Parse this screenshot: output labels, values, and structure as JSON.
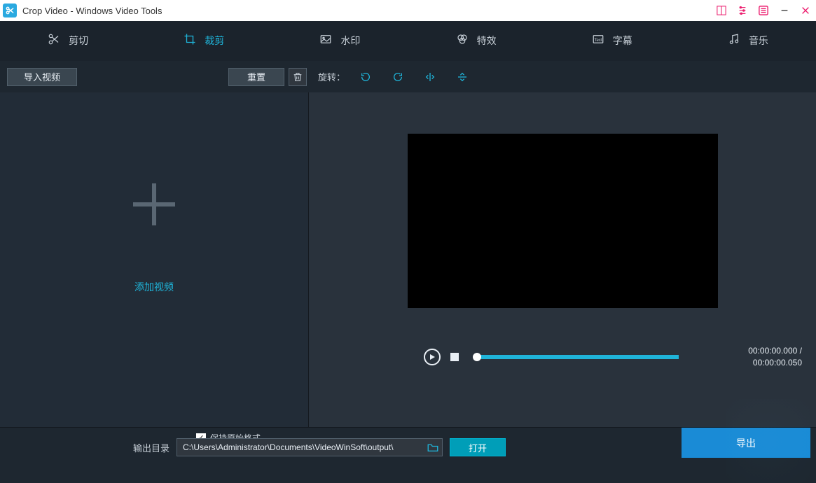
{
  "titlebar": {
    "title": "Crop Video - Windows Video Tools"
  },
  "tabs": [
    {
      "label": "剪切",
      "icon": "scissors-icon"
    },
    {
      "label": "裁剪",
      "icon": "crop-icon",
      "active": true
    },
    {
      "label": "水印",
      "icon": "watermark-icon"
    },
    {
      "label": "特效",
      "icon": "effects-icon"
    },
    {
      "label": "字幕",
      "icon": "subtitle-icon"
    },
    {
      "label": "音乐",
      "icon": "music-icon"
    }
  ],
  "toolbar": {
    "import_label": "导入视频",
    "reset_label": "重置",
    "rotate_label": "旋转："
  },
  "dropzone": {
    "text": "添加视频"
  },
  "player": {
    "time_current": "00:00:00.000",
    "time_total": "00:00:00.050",
    "separator": " / "
  },
  "bottom": {
    "keep_original_label": "保持原始格式",
    "output_dir_label": "输出目录",
    "output_path": "C:\\Users\\Administrator\\Documents\\VideoWinSoft\\output\\",
    "open_label": "打开",
    "export_label": "导出"
  }
}
